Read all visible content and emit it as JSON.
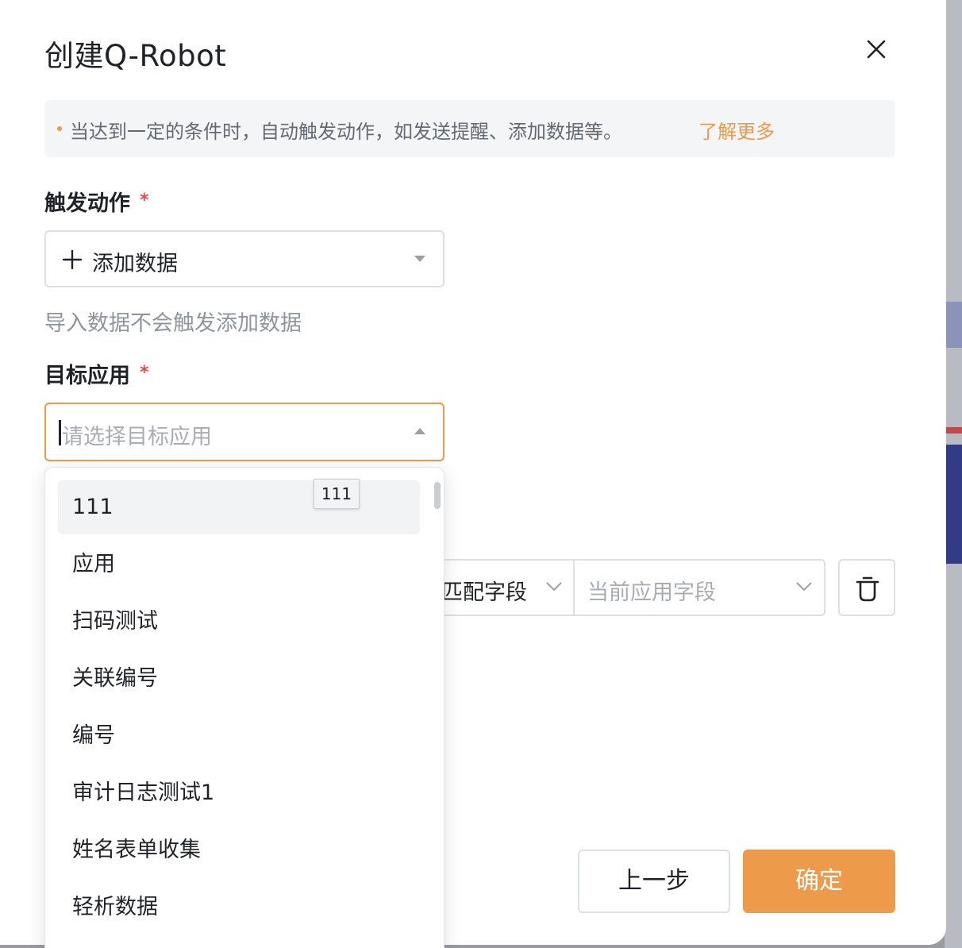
{
  "dialog": {
    "title": "创建Q-Robot",
    "close_icon": "close-icon"
  },
  "banner": {
    "text": "当达到一定的条件时，自动触发动作，如发送提醒、添加数据等。",
    "link": "了解更多",
    "accent_color": "#ee9a4b"
  },
  "trigger_action": {
    "label": "触发动作",
    "required_mark": "*",
    "icon": "plus-icon",
    "value": "添加数据",
    "hint": "导入数据不会触发添加数据"
  },
  "target_app": {
    "label": "目标应用",
    "required_mark": "*",
    "placeholder": "请选择目标应用",
    "dropdown_open": true
  },
  "dropdown": {
    "tooltip": "111",
    "items": [
      {
        "label": "111",
        "active": true
      },
      {
        "label": "应用"
      },
      {
        "label": "扫码测试"
      },
      {
        "label": "关联编号"
      },
      {
        "label": "编号"
      },
      {
        "label": "审计日志测试1"
      },
      {
        "label": "姓名表单收集"
      },
      {
        "label": "轻析数据"
      }
    ]
  },
  "field_mapping": {
    "match_field": "匹配字段",
    "current_field_placeholder": "当前应用字段",
    "delete_icon": "trash-icon"
  },
  "footer": {
    "prev_label": "上一步",
    "ok_label": "确定",
    "ok_color": "#ee9a4b"
  }
}
